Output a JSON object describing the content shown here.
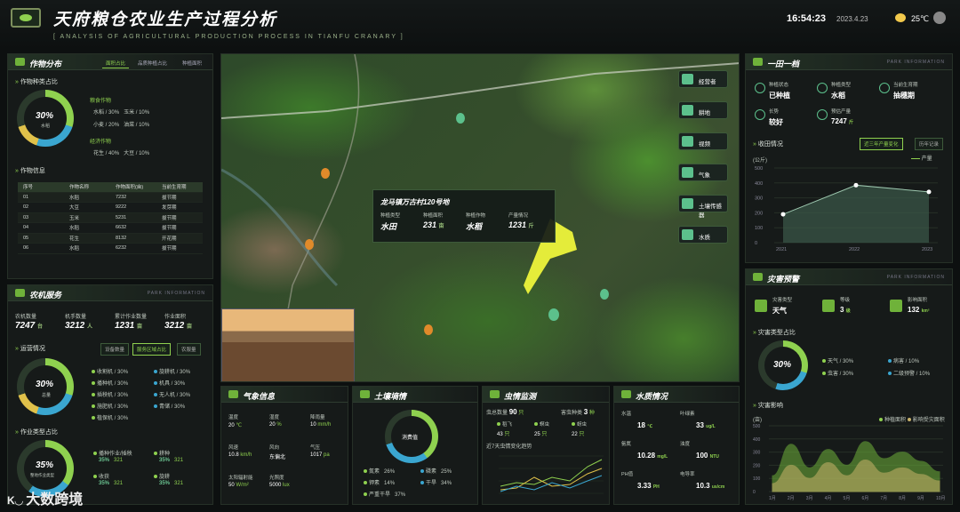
{
  "header": {
    "title": "天府粮仓农业生产过程分析",
    "subtitle": "[ ANALYSIS OF AGRICULTURAL PRODUCTION PROCESS IN TIANFU CRANARY ]",
    "time": "16:54:23",
    "date": "2023.4.23",
    "temp": "25℃"
  },
  "crop": {
    "title": "作物分布",
    "tabs": [
      "面积占比",
      "品质种植占比",
      "种植面积"
    ],
    "sec1": "作物种类占比",
    "ring_value": "30%",
    "ring_sub": "水稻",
    "grain_label": "粮食作物",
    "cash_label": "经济作物",
    "grain": [
      {
        "n": "水稻",
        "p": "30%",
        "n2": "玉米",
        "p2": "10%"
      },
      {
        "n": "小麦",
        "p": "20%",
        "n2": "油菜",
        "p2": "10%"
      }
    ],
    "cash": [
      {
        "n": "花生",
        "p": "40%",
        "n2": "大豆",
        "p2": "10%"
      }
    ],
    "sec2": "作物信息",
    "table_head": [
      "序号",
      "作物名称",
      "作物面积(亩)",
      "当前生育期"
    ],
    "rows": [
      [
        "01",
        "水稻",
        "7232",
        "拔节期"
      ],
      [
        "02",
        "大豆",
        "9222",
        "发芽期"
      ],
      [
        "03",
        "玉米",
        "5231",
        "拔节期"
      ],
      [
        "04",
        "水稻",
        "6632",
        "拔节期"
      ],
      [
        "05",
        "花生",
        "8132",
        "开花期"
      ],
      [
        "06",
        "水稻",
        "6232",
        "拔节期"
      ]
    ]
  },
  "machine": {
    "title": "农机服务",
    "eng": "PARK INFORMATION",
    "stats": [
      {
        "l": "农机数量",
        "v": "7247",
        "u": "台"
      },
      {
        "l": "机手数量",
        "v": "3212",
        "u": "人"
      },
      {
        "l": "累计作业数量",
        "v": "1231",
        "u": "亩"
      },
      {
        "l": "作业面积",
        "v": "3212",
        "u": "亩"
      }
    ],
    "sec1": "运营情况",
    "tabs": [
      "设备数量",
      "服务区域占比",
      "农服量"
    ],
    "ring_value": "30%",
    "ring_sub": "总量",
    "ops": [
      [
        "收割机",
        "30%",
        "旋耕机",
        "30%"
      ],
      [
        "播种机",
        "30%",
        "机具",
        "30%"
      ],
      [
        "插秧机",
        "30%",
        "无人机",
        "30%"
      ],
      [
        "施肥机",
        "30%",
        "青储",
        "30%"
      ],
      [
        "植保机",
        "30%",
        "",
        ""
      ]
    ],
    "sec2": "作业类型占比",
    "ring2_value": "35%",
    "ring2_sub": "整地作业类型",
    "types": [
      {
        "n": "播种作业/插秧",
        "p": "35%",
        "v": "321"
      },
      {
        "n": "耕种",
        "p": "35%",
        "v": "321"
      },
      {
        "n": "收获",
        "p": "35%",
        "v": "321"
      },
      {
        "n": "旋耕",
        "p": "35%",
        "v": "321"
      }
    ]
  },
  "map": {
    "popup": {
      "title": "龙马镇万古村120号地",
      "labels": [
        "种植类型",
        "种植面积",
        "种植作物",
        "产量情况"
      ],
      "values": [
        "水田",
        "231",
        "水稻",
        "1231"
      ],
      "units": [
        "",
        "亩",
        "",
        "斤"
      ]
    },
    "buttons": [
      "经营者",
      "耕地",
      "视频",
      "气象",
      "土壤传感器",
      "水质"
    ]
  },
  "weather": {
    "title": "气象信息",
    "items": [
      {
        "l": "温度",
        "v": "20",
        "u": "℃"
      },
      {
        "l": "湿度",
        "v": "20",
        "u": "%"
      },
      {
        "l": "降雨量",
        "v": "10",
        "u": "mm/h"
      },
      {
        "l": "风速",
        "v": "10.8",
        "u": "km/h"
      },
      {
        "l": "风向",
        "v": "东偏北",
        "u": ""
      },
      {
        "l": "气压",
        "v": "1017",
        "u": "pa"
      },
      {
        "l": "太阳辐射能",
        "v": "50",
        "u": "W/m²"
      },
      {
        "l": "光照度",
        "v": "5000",
        "u": "lux"
      }
    ]
  },
  "soil": {
    "title": "土壤墒情",
    "center": "消费值",
    "items": [
      [
        "氮素",
        "26%",
        "磷素",
        "25%"
      ],
      [
        "钾素",
        "14%",
        "干旱",
        "34%"
      ],
      [
        "严重干旱",
        "37%",
        "",
        ""
      ]
    ]
  },
  "pest": {
    "title": "虫情监测",
    "total_l": "虫总数量",
    "total_v": "90",
    "total_u": "只",
    "kinds_l": "害虫种类",
    "kinds_v": "3",
    "kinds_u": "种",
    "items": [
      {
        "n": "稻飞",
        "v": "43",
        "u": "只"
      },
      {
        "n": "螟虫",
        "v": "25",
        "u": "只"
      },
      {
        "n": "蚜虫",
        "v": "22",
        "u": "只"
      }
    ],
    "chart_title": "近7天虫情变化趋势"
  },
  "water": {
    "title": "水质情况",
    "items": [
      {
        "l": "水温",
        "v": "18",
        "u": "℃"
      },
      {
        "l": "叶绿素",
        "v": "33",
        "u": "ug/L"
      },
      {
        "l": "氨氮",
        "v": "10.28",
        "u": "mg/L"
      },
      {
        "l": "浊度",
        "v": "100",
        "u": "NTU"
      },
      {
        "l": "PH值",
        "v": "3.33",
        "u": "PH"
      },
      {
        "l": "电导率",
        "v": "10.3",
        "u": "us/cm"
      }
    ]
  },
  "field": {
    "title": "一田一档",
    "eng": "PARK INFORMATION",
    "info": [
      {
        "l": "种植状态",
        "v": "已种植"
      },
      {
        "l": "种植类型",
        "v": "水稻"
      },
      {
        "l": "当前生育期",
        "v": "抽穗期"
      },
      {
        "l": "长势",
        "v": "较好"
      },
      {
        "l": "预估产量",
        "v": "7247",
        "u": "斤"
      }
    ],
    "sec": "收田情况",
    "chips": [
      "近三年产量变化",
      "历年记录"
    ],
    "legend": "产量",
    "unit": "(公斤)",
    "chart_data": {
      "type": "area",
      "categories": [
        "2021",
        "2022",
        "2023"
      ],
      "values": [
        190,
        385,
        340
      ],
      "ylim": [
        0,
        500
      ],
      "yticks": [
        "0",
        "100",
        "200",
        "300",
        "400",
        "500"
      ]
    }
  },
  "disaster": {
    "title": "灾害预警",
    "eng": "PARK INFORMATION",
    "items": [
      {
        "l": "灾害类型",
        "v": "天气"
      },
      {
        "l": "等级",
        "v": "3",
        "u": "级"
      },
      {
        "l": "影响面积",
        "v": "132",
        "u": "km²"
      }
    ],
    "sec1": "灾害类型占比",
    "ring_value": "30%",
    "ring_sub": "总量",
    "types": [
      [
        "天气",
        "30%",
        "病害",
        "10%"
      ],
      [
        "虫害",
        "30%",
        "二级预警",
        "10%"
      ]
    ],
    "sec2": "灾害影响",
    "unit": "(亩)",
    "legend": [
      "种植面积",
      "影响受灾面积"
    ],
    "chart_data": {
      "type": "area",
      "categories": [
        "1月",
        "2月",
        "3月",
        "4月",
        "5月",
        "6月",
        "7月",
        "8月",
        "9月",
        "10月"
      ],
      "series": [
        {
          "name": "种植面积",
          "values": [
            120,
            360,
            180,
            320,
            200,
            380,
            250,
            300,
            230,
            150
          ]
        },
        {
          "name": "影响受灾面积",
          "values": [
            60,
            200,
            100,
            220,
            120,
            240,
            140,
            180,
            130,
            80
          ]
        }
      ],
      "ylim": [
        0,
        500
      ]
    }
  },
  "watermark": "大数跨境"
}
